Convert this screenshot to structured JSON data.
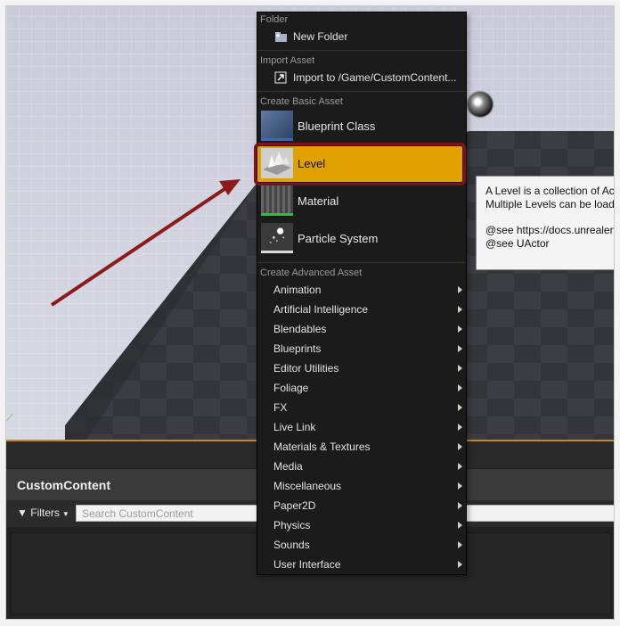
{
  "menu": {
    "sections": {
      "folder": "Folder",
      "import_asset": "Import Asset",
      "create_basic": "Create Basic Asset",
      "create_advanced": "Create Advanced Asset"
    },
    "new_folder": {
      "label": "New Folder",
      "icon": "new-folder-icon"
    },
    "import": {
      "label": "Import to /Game/CustomContent...",
      "icon": "import-icon"
    },
    "basic_items": [
      {
        "label": "Blueprint Class",
        "icon": "blueprint-class-icon"
      },
      {
        "label": "Level",
        "icon": "level-icon",
        "highlighted": true
      },
      {
        "label": "Material",
        "icon": "material-icon"
      },
      {
        "label": "Particle System",
        "icon": "particle-system-icon"
      }
    ],
    "advanced_items": [
      "Animation",
      "Artificial Intelligence",
      "Blendables",
      "Blueprints",
      "Editor Utilities",
      "Foliage",
      "FX",
      "Live Link",
      "Materials & Textures",
      "Media",
      "Miscellaneous",
      "Paper2D",
      "Physics",
      "Sounds",
      "User Interface"
    ]
  },
  "tooltip": {
    "line1": "A Level is a collection of Act",
    "line2": "Multiple Levels can be loade",
    "line3": "@see https://docs.unrealeng",
    "line4": "@see UActor"
  },
  "content_browser": {
    "title": "CustomContent",
    "filters_label": "Filters",
    "search_placeholder": "Search CustomContent"
  },
  "colors": {
    "highlight": "#e0a100",
    "highlight_border": "#7d1418",
    "annotation_arrow": "#8b1a1a",
    "menu_bg": "#1b1b1b"
  }
}
